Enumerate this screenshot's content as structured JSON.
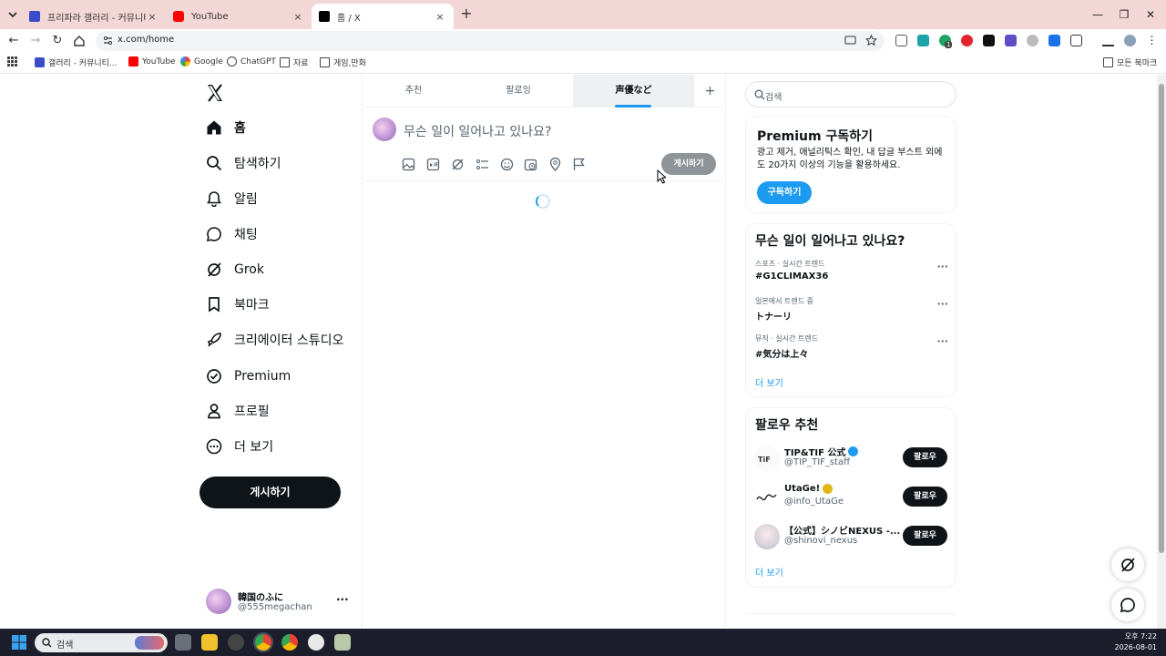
{
  "browser": {
    "tabs": [
      {
        "label": "프리파라 갤러리 - 커뮤니티 포",
        "close": "×"
      },
      {
        "label": "YouTube",
        "close": "×"
      },
      {
        "label": "홈 / X",
        "close": "×"
      }
    ],
    "new_tab": "+",
    "url": "x.com/home",
    "bookmarks": [
      {
        "label": "갤러리 - 커뮤니티..."
      },
      {
        "label": "YouTube"
      },
      {
        "label": "Google"
      },
      {
        "label": "ChatGPT"
      },
      {
        "label": "자료"
      },
      {
        "label": "게임,만화"
      }
    ],
    "all_bookmarks": "모든 북마크",
    "extension_badge": "1",
    "colors": {
      "tabstrip": "#f3d6d6",
      "accent": "#1d9bf0"
    }
  },
  "sidebar": {
    "items": [
      {
        "label": "홈",
        "icon": "home-icon"
      },
      {
        "label": "탐색하기",
        "icon": "search-icon"
      },
      {
        "label": "알림",
        "icon": "bell-icon"
      },
      {
        "label": "채팅",
        "icon": "chat-icon"
      },
      {
        "label": "Grok",
        "icon": "grok-icon"
      },
      {
        "label": "북마크",
        "icon": "bookmark-icon"
      },
      {
        "label": "크리에이터 스튜디오",
        "icon": "rocket-icon"
      },
      {
        "label": "Premium",
        "icon": "verified-icon"
      },
      {
        "label": "프로필",
        "icon": "person-icon"
      },
      {
        "label": "더 보기",
        "icon": "more-circle-icon"
      }
    ],
    "post_button": "게시하기",
    "account": {
      "name": "韓国のふに",
      "handle": "@555megachan",
      "more": "···"
    }
  },
  "feed": {
    "tabs": [
      "추천",
      "팔로잉",
      "声優など"
    ],
    "add_tab": "+",
    "composer": {
      "placeholder": "무슨 일이 일어나고 있나요?",
      "post_button": "게시하기"
    }
  },
  "right": {
    "search_placeholder": "검색",
    "premium": {
      "title": "Premium 구독하기",
      "description": "광고 제거, 애널리틱스 확인, 내 답글 부스트 외에 도 20가지 이상의 기능을 활용하세요.",
      "button": "구독하기"
    },
    "trends": {
      "title": "무슨 일이 일어나고 있나요?",
      "items": [
        {
          "meta": "스포츠 · 실시간 트렌드",
          "name": "#G1CLIMAX36"
        },
        {
          "meta": "일본에서 트렌드 중",
          "name": "トナーリ"
        },
        {
          "meta": "뮤직 · 실시간 트렌드",
          "name": "#気分は上々"
        }
      ],
      "show_more": "더 보기",
      "dots": "···"
    },
    "who_to_follow": {
      "title": "팔로우 추천",
      "users": [
        {
          "name": "TIP&TIF 公式",
          "handle": "@TIP_TIF_staff",
          "button": "팔로우"
        },
        {
          "name": "UtaGe!",
          "handle": "@info_UtaGe",
          "button": "팔로우"
        },
        {
          "name": "【公式】シノビNEXUS -...",
          "handle": "@shinovi_nexus",
          "button": "팔로우"
        }
      ],
      "show_more": "더 보기"
    }
  },
  "taskbar": {
    "search": "검색",
    "time": "오후 7:22",
    "date": "2026-08-01"
  }
}
